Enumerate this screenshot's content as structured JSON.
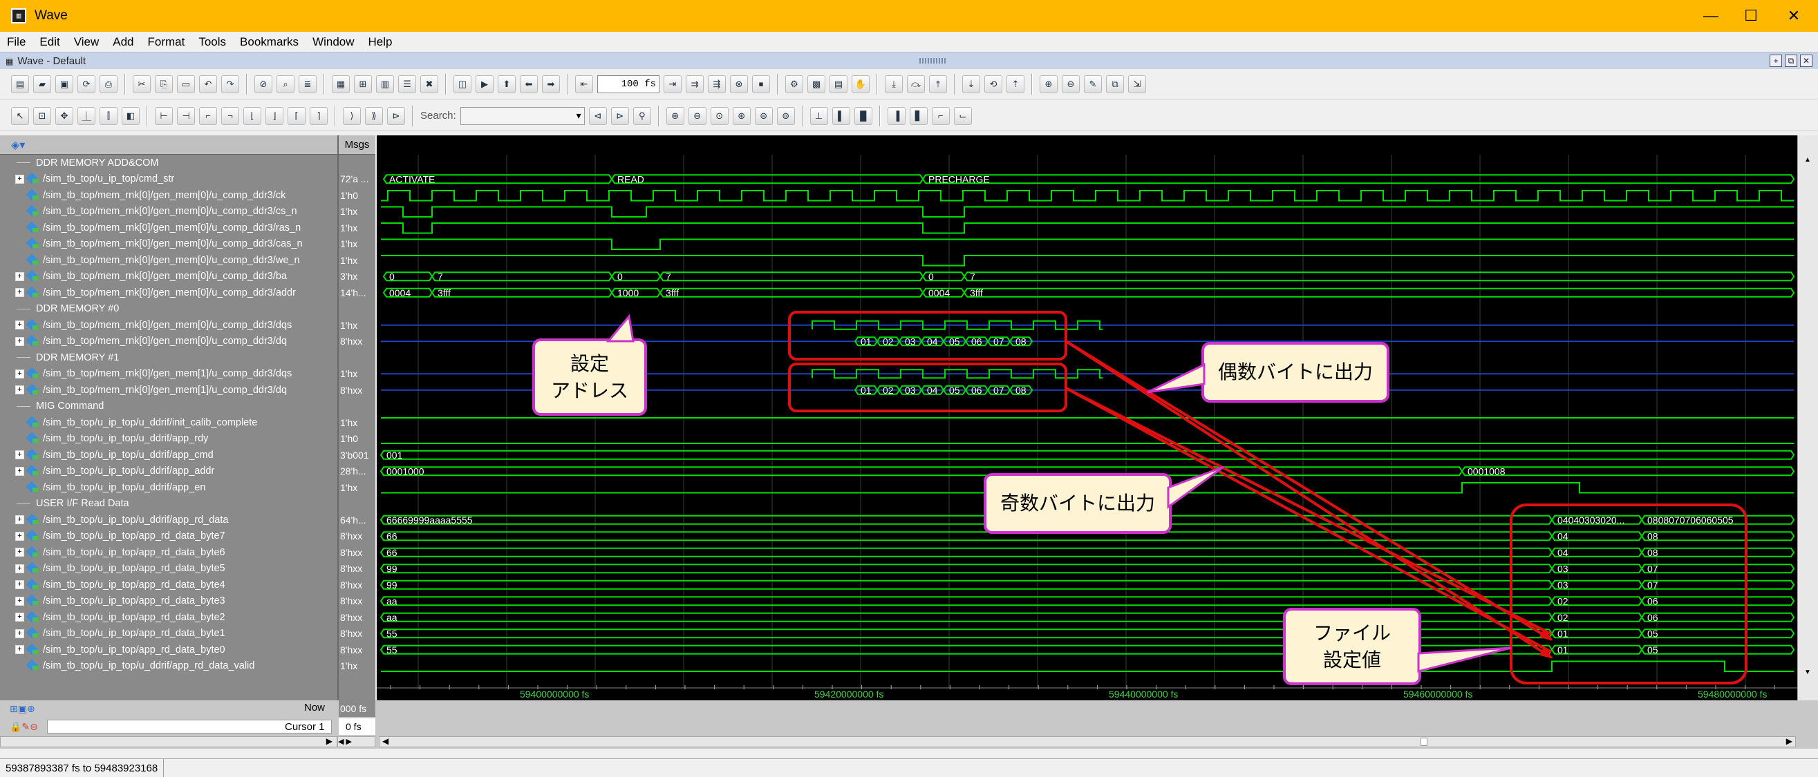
{
  "window": {
    "title": "Wave",
    "minimize": "—",
    "maximize": "☐",
    "close": "✕"
  },
  "menu": [
    "File",
    "Edit",
    "View",
    "Add",
    "Format",
    "Tools",
    "Bookmarks",
    "Window",
    "Help"
  ],
  "subheader": {
    "title": "Wave - Default"
  },
  "toolbar": {
    "zoom_value": "100",
    "zoom_unit": "fs",
    "search_label": "Search:"
  },
  "columns": {
    "msgs": "Msgs"
  },
  "dividers": {
    "d0": "DDR MEMORY ADD&COM",
    "d1": "DDR MEMORY #0",
    "d2": "DDR MEMORY #1",
    "d3": "MIG Command",
    "d4": "USER I/F Read Data"
  },
  "signals": [
    {
      "name": "/sim_tb_top/u_ip_top/cmd_str",
      "msg": "72'a ..."
    },
    {
      "name": "/sim_tb_top/mem_rnk[0]/gen_mem[0]/u_comp_ddr3/ck",
      "msg": "1'h0"
    },
    {
      "name": "/sim_tb_top/mem_rnk[0]/gen_mem[0]/u_comp_ddr3/cs_n",
      "msg": "1'hx"
    },
    {
      "name": "/sim_tb_top/mem_rnk[0]/gen_mem[0]/u_comp_ddr3/ras_n",
      "msg": "1'hx"
    },
    {
      "name": "/sim_tb_top/mem_rnk[0]/gen_mem[0]/u_comp_ddr3/cas_n",
      "msg": "1'hx"
    },
    {
      "name": "/sim_tb_top/mem_rnk[0]/gen_mem[0]/u_comp_ddr3/we_n",
      "msg": "1'hx"
    },
    {
      "name": "/sim_tb_top/mem_rnk[0]/gen_mem[0]/u_comp_ddr3/ba",
      "msg": "3'hx"
    },
    {
      "name": "/sim_tb_top/mem_rnk[0]/gen_mem[0]/u_comp_ddr3/addr",
      "msg": "14'h..."
    },
    {
      "name": "/sim_tb_top/mem_rnk[0]/gen_mem[0]/u_comp_ddr3/dqs",
      "msg": "1'hx"
    },
    {
      "name": "/sim_tb_top/mem_rnk[0]/gen_mem[0]/u_comp_ddr3/dq",
      "msg": "8'hxx"
    },
    {
      "name": "/sim_tb_top/mem_rnk[0]/gen_mem[1]/u_comp_ddr3/dqs",
      "msg": "1'hx"
    },
    {
      "name": "/sim_tb_top/mem_rnk[0]/gen_mem[1]/u_comp_ddr3/dq",
      "msg": "8'hxx"
    },
    {
      "name": "/sim_tb_top/u_ip_top/u_ddrif/init_calib_complete",
      "msg": "1'hx"
    },
    {
      "name": "/sim_tb_top/u_ip_top/u_ddrif/app_rdy",
      "msg": "1'h0"
    },
    {
      "name": "/sim_tb_top/u_ip_top/u_ddrif/app_cmd",
      "msg": "3'b001"
    },
    {
      "name": "/sim_tb_top/u_ip_top/u_ddrif/app_addr",
      "msg": "28'h..."
    },
    {
      "name": "/sim_tb_top/u_ip_top/u_ddrif/app_en",
      "msg": "1'hx"
    },
    {
      "name": "/sim_tb_top/u_ip_top/u_ddrif/app_rd_data",
      "msg": "64'h..."
    },
    {
      "name": "/sim_tb_top/u_ip_top/app_rd_data_byte7",
      "msg": "8'hxx"
    },
    {
      "name": "/sim_tb_top/u_ip_top/app_rd_data_byte6",
      "msg": "8'hxx"
    },
    {
      "name": "/sim_tb_top/u_ip_top/app_rd_data_byte5",
      "msg": "8'hxx"
    },
    {
      "name": "/sim_tb_top/u_ip_top/app_rd_data_byte4",
      "msg": "8'hxx"
    },
    {
      "name": "/sim_tb_top/u_ip_top/app_rd_data_byte3",
      "msg": "8'hxx"
    },
    {
      "name": "/sim_tb_top/u_ip_top/app_rd_data_byte2",
      "msg": "8'hxx"
    },
    {
      "name": "/sim_tb_top/u_ip_top/app_rd_data_byte1",
      "msg": "8'hxx"
    },
    {
      "name": "/sim_tb_top/u_ip_top/app_rd_data_byte0",
      "msg": "8'hxx"
    },
    {
      "name": "/sim_tb_top/u_ip_top/u_ddrif/app_rd_data_valid",
      "msg": "1'hx"
    }
  ],
  "wave_labels": {
    "cmd": [
      "ACTIVATE",
      "READ",
      "PRECHARGE"
    ],
    "ba": [
      "0",
      "7",
      "0",
      "7",
      "0",
      "7"
    ],
    "addr": [
      "0004",
      "3fff",
      "1000",
      "3fff",
      "0004",
      "3fff"
    ],
    "dq": [
      "01",
      "02",
      "03",
      "04",
      "05",
      "06",
      "07",
      "08"
    ],
    "app_cmd": "001",
    "app_addr": [
      "0001000",
      "0001008"
    ],
    "rd_data": [
      "66669999aaaa5555",
      "04040303020...",
      "0808070706060505"
    ],
    "bytes_before": [
      "66",
      "66",
      "99",
      "99",
      "aa",
      "aa",
      "55",
      "55"
    ],
    "bytes_after1": [
      "04",
      "04",
      "03",
      "03",
      "02",
      "02",
      "01",
      "01"
    ],
    "bytes_after2": [
      "08",
      "08",
      "07",
      "07",
      "06",
      "06",
      "05",
      "05"
    ]
  },
  "timeline": [
    "59400000000 fs",
    "59420000000 fs",
    "59440000000 fs",
    "59460000000 fs",
    "59480000000 fs"
  ],
  "bottom": {
    "now_label": "Now",
    "now_value": "000 fs",
    "cursor_label": "Cursor 1",
    "cursor_value": "0 fs"
  },
  "status": {
    "range": "59387893387 fs to 59483923168"
  },
  "callouts": {
    "addr_note_line1": "設定",
    "addr_note_line2": "アドレス",
    "even_bytes": "偶数バイトに出力",
    "odd_bytes": "奇数バイトに出力",
    "file_line1": "ファイル",
    "file_line2": "設定値"
  },
  "colors": {
    "wave": "#00e000",
    "annotation_red": "#e01010",
    "callout_border": "#cc33cc",
    "titlebar": "#ffb800"
  }
}
